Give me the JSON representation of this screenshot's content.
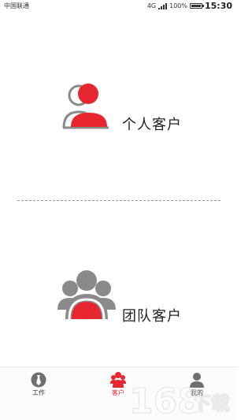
{
  "status_bar": {
    "carrier": "中国联通",
    "network": "4G",
    "battery": "100%",
    "time": "15:30"
  },
  "options": [
    {
      "label": "个人客户",
      "icon": "person-icon"
    },
    {
      "label": "团队客户",
      "icon": "team-icon"
    }
  ],
  "tabs": [
    {
      "label": "工作",
      "icon": "tie-icon",
      "active": false
    },
    {
      "label": "客户",
      "icon": "customers-icon",
      "active": true
    },
    {
      "label": "我的",
      "icon": "profile-icon",
      "active": false
    }
  ],
  "watermark": {
    "number": "168",
    "text": "下载"
  },
  "colors": {
    "accent": "#e8262f",
    "icon_gray": "#8a8a8a",
    "text": "#222222"
  }
}
